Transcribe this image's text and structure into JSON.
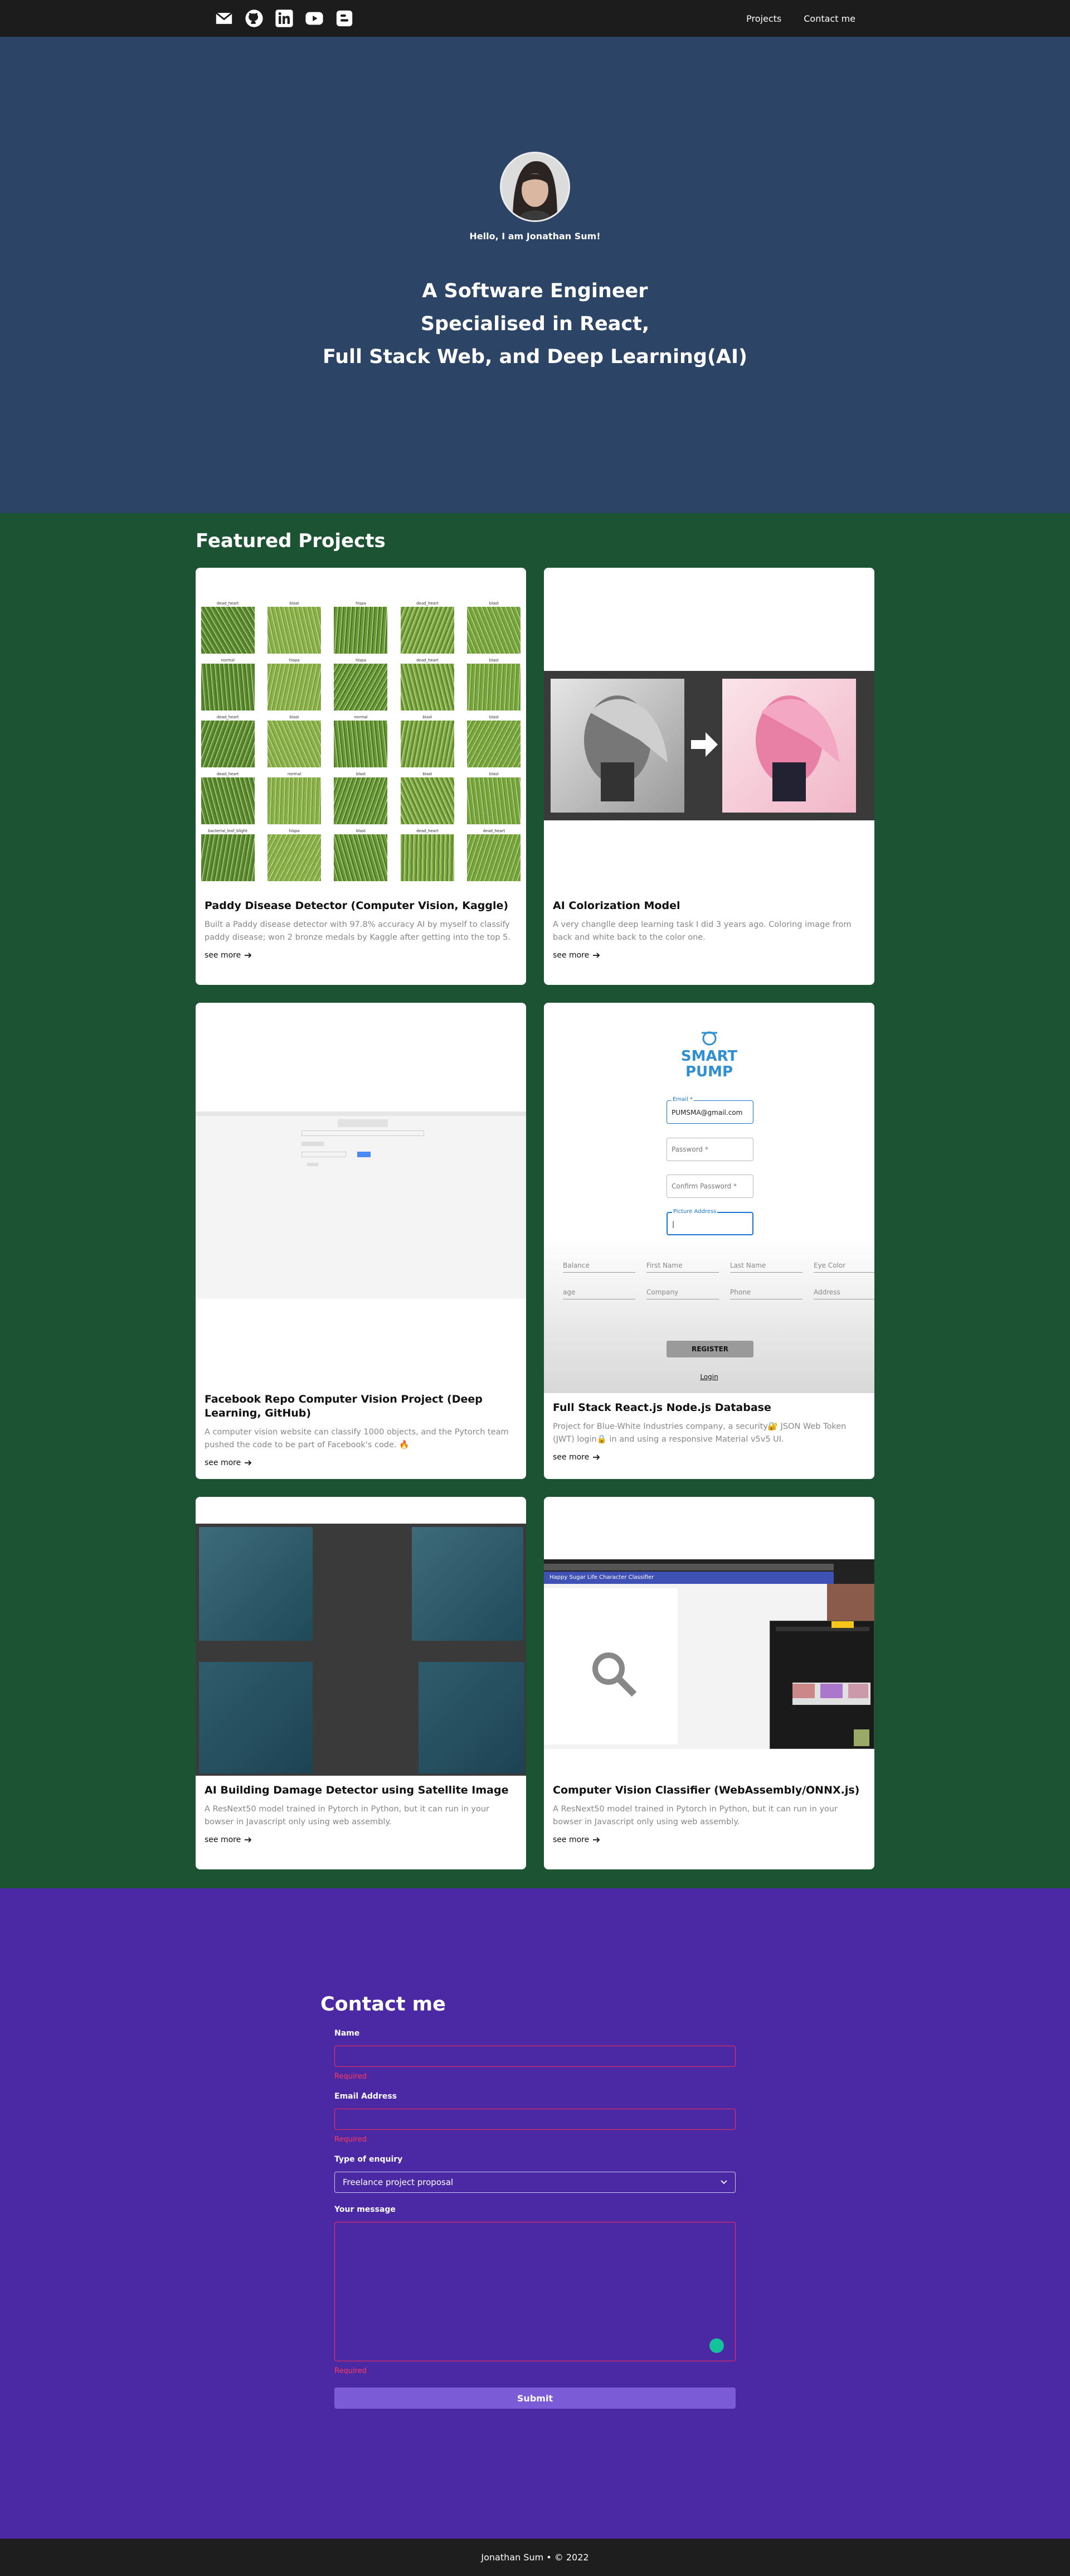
{
  "nav": {
    "icons": [
      "mail-icon",
      "github-icon",
      "linkedin-icon",
      "youtube-icon",
      "blogger-icon"
    ],
    "links": [
      "Projects",
      "Contact me"
    ]
  },
  "hero": {
    "hello": "Hello, I am Jonathan Sum!",
    "title_line1": "A Software Engineer",
    "title_line2": "Specialised in React,",
    "title_line3": "Full Stack Web, and Deep Learning(AI)"
  },
  "projects": {
    "heading": "Featured Projects",
    "see_more": "see more",
    "items": [
      {
        "title": "Paddy Disease Detector (Computer Vision, Kaggle)",
        "desc": "Built a Paddy disease detector with 97.8% accuracy AI by myself to classify paddy disease; won 2 bronze medals by Kaggle after getting into the top 5.",
        "image_labels": [
          "dead_heart",
          "blast",
          "hispa",
          "dead_heart",
          "blast",
          "normal",
          "hispa",
          "hispa",
          "dead_heart",
          "blast",
          "dead_heart",
          "blast",
          "normal",
          "blast",
          "blast",
          "dead_heart",
          "normal",
          "blast",
          "blast",
          "blast",
          "bacterial_leaf_blight",
          "hispa",
          "blast",
          "dead_heart",
          "dead_heart"
        ]
      },
      {
        "title": "AI Colorization Model",
        "desc": "A very changlle deep learning task I did 3 years ago. Coloring image from back and white back to the color one."
      },
      {
        "title": "Facebook Repo Computer Vision Project (Deep Learning, GitHub)",
        "desc": "A computer vision website can classify 1000 objects, and the Pytorch team pushed the code to be part of Facebook's code. 🔥"
      },
      {
        "title": "Full Stack React.js Node.js Database",
        "desc": "Project for Blue-White Industries company, a security🔐 JSON Web Token (JWT) login🔒 in and using a responsive Material v5v5 UI.",
        "logo_line1": "SMART",
        "logo_line2": "PUMP",
        "email_label": "Email *",
        "email_value": "PUMSMA@gmail.com",
        "password": "Password *",
        "confirm_password": "Confirm Password *",
        "picture_address": "Picture Address",
        "row1": [
          "Balance",
          "First Name",
          "Last Name",
          "Eye Color"
        ],
        "row2": [
          "age",
          "Company",
          "Phone",
          "Address"
        ],
        "register": "REGISTER",
        "login": "Login"
      },
      {
        "title": "AI Building Damage Detector using Satellite Image",
        "desc": "A ResNext50 model trained in Pytorch in Python, but it can run in your bowser in Javascript only using web assembly."
      },
      {
        "title": "Computer Vision Classifier (WebAssembly/ONNX.js)",
        "desc": "A ResNext50 model trained in Pytorch in Python, but it can run in your bowser in Javascript only using web assembly.",
        "app_title": "Happy Sugar Life Character Classifier"
      }
    ]
  },
  "contact": {
    "heading": "Contact me",
    "name_label": "Name",
    "email_label": "Email Address",
    "enquiry_label": "Type of enquiry",
    "enquiry_value": "Freelance project proposal",
    "message_label": "Your message",
    "required": "Required",
    "submit": "Submit"
  },
  "footer": {
    "text": "Jonathan Sum • © 2022"
  }
}
